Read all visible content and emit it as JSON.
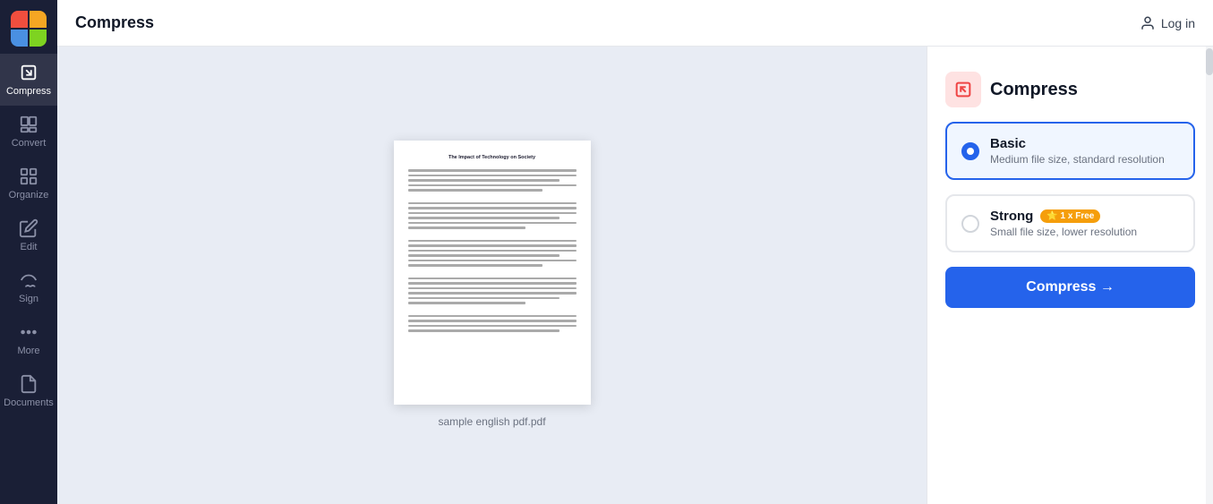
{
  "app": {
    "name": "Compress",
    "logo_colors": [
      "#f04e3e",
      "#f5a623",
      "#4a90e2",
      "#7ed321"
    ]
  },
  "header": {
    "title": "Compress",
    "login_label": "Log in"
  },
  "sidebar": {
    "items": [
      {
        "id": "compress",
        "label": "Compress",
        "active": true
      },
      {
        "id": "convert",
        "label": "Convert",
        "active": false
      },
      {
        "id": "organize",
        "label": "Organize",
        "active": false
      },
      {
        "id": "edit",
        "label": "Edit",
        "active": false
      },
      {
        "id": "sign",
        "label": "Sign",
        "active": false
      },
      {
        "id": "more",
        "label": "More",
        "active": false
      },
      {
        "id": "documents",
        "label": "Documents",
        "active": false
      }
    ]
  },
  "preview": {
    "filename": "sample english pdf.pdf",
    "pdf_title": "The Impact of Technology on Society"
  },
  "panel": {
    "title": "Compress",
    "options": [
      {
        "id": "basic",
        "name": "Basic",
        "description": "Medium file size, standard resolution",
        "selected": true,
        "badge": null
      },
      {
        "id": "strong",
        "name": "Strong",
        "description": "Small file size, lower resolution",
        "selected": false,
        "badge": "⭐ 1 x Free"
      }
    ],
    "compress_button": "Compress →"
  }
}
